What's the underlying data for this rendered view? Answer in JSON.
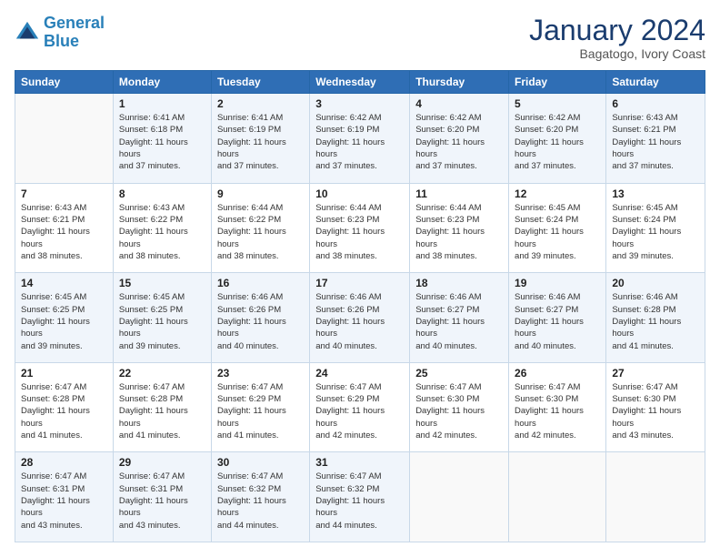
{
  "header": {
    "logo_line1": "General",
    "logo_line2": "Blue",
    "month": "January 2024",
    "location": "Bagatogo, Ivory Coast"
  },
  "weekdays": [
    "Sunday",
    "Monday",
    "Tuesday",
    "Wednesday",
    "Thursday",
    "Friday",
    "Saturday"
  ],
  "weeks": [
    [
      {
        "day": "",
        "sunrise": "",
        "sunset": "",
        "daylight": ""
      },
      {
        "day": "1",
        "sunrise": "Sunrise: 6:41 AM",
        "sunset": "Sunset: 6:18 PM",
        "daylight": "Daylight: 11 hours and 37 minutes."
      },
      {
        "day": "2",
        "sunrise": "Sunrise: 6:41 AM",
        "sunset": "Sunset: 6:19 PM",
        "daylight": "Daylight: 11 hours and 37 minutes."
      },
      {
        "day": "3",
        "sunrise": "Sunrise: 6:42 AM",
        "sunset": "Sunset: 6:19 PM",
        "daylight": "Daylight: 11 hours and 37 minutes."
      },
      {
        "day": "4",
        "sunrise": "Sunrise: 6:42 AM",
        "sunset": "Sunset: 6:20 PM",
        "daylight": "Daylight: 11 hours and 37 minutes."
      },
      {
        "day": "5",
        "sunrise": "Sunrise: 6:42 AM",
        "sunset": "Sunset: 6:20 PM",
        "daylight": "Daylight: 11 hours and 37 minutes."
      },
      {
        "day": "6",
        "sunrise": "Sunrise: 6:43 AM",
        "sunset": "Sunset: 6:21 PM",
        "daylight": "Daylight: 11 hours and 37 minutes."
      }
    ],
    [
      {
        "day": "7",
        "sunrise": "Sunrise: 6:43 AM",
        "sunset": "Sunset: 6:21 PM",
        "daylight": "Daylight: 11 hours and 38 minutes."
      },
      {
        "day": "8",
        "sunrise": "Sunrise: 6:43 AM",
        "sunset": "Sunset: 6:22 PM",
        "daylight": "Daylight: 11 hours and 38 minutes."
      },
      {
        "day": "9",
        "sunrise": "Sunrise: 6:44 AM",
        "sunset": "Sunset: 6:22 PM",
        "daylight": "Daylight: 11 hours and 38 minutes."
      },
      {
        "day": "10",
        "sunrise": "Sunrise: 6:44 AM",
        "sunset": "Sunset: 6:23 PM",
        "daylight": "Daylight: 11 hours and 38 minutes."
      },
      {
        "day": "11",
        "sunrise": "Sunrise: 6:44 AM",
        "sunset": "Sunset: 6:23 PM",
        "daylight": "Daylight: 11 hours and 38 minutes."
      },
      {
        "day": "12",
        "sunrise": "Sunrise: 6:45 AM",
        "sunset": "Sunset: 6:24 PM",
        "daylight": "Daylight: 11 hours and 39 minutes."
      },
      {
        "day": "13",
        "sunrise": "Sunrise: 6:45 AM",
        "sunset": "Sunset: 6:24 PM",
        "daylight": "Daylight: 11 hours and 39 minutes."
      }
    ],
    [
      {
        "day": "14",
        "sunrise": "Sunrise: 6:45 AM",
        "sunset": "Sunset: 6:25 PM",
        "daylight": "Daylight: 11 hours and 39 minutes."
      },
      {
        "day": "15",
        "sunrise": "Sunrise: 6:45 AM",
        "sunset": "Sunset: 6:25 PM",
        "daylight": "Daylight: 11 hours and 39 minutes."
      },
      {
        "day": "16",
        "sunrise": "Sunrise: 6:46 AM",
        "sunset": "Sunset: 6:26 PM",
        "daylight": "Daylight: 11 hours and 40 minutes."
      },
      {
        "day": "17",
        "sunrise": "Sunrise: 6:46 AM",
        "sunset": "Sunset: 6:26 PM",
        "daylight": "Daylight: 11 hours and 40 minutes."
      },
      {
        "day": "18",
        "sunrise": "Sunrise: 6:46 AM",
        "sunset": "Sunset: 6:27 PM",
        "daylight": "Daylight: 11 hours and 40 minutes."
      },
      {
        "day": "19",
        "sunrise": "Sunrise: 6:46 AM",
        "sunset": "Sunset: 6:27 PM",
        "daylight": "Daylight: 11 hours and 40 minutes."
      },
      {
        "day": "20",
        "sunrise": "Sunrise: 6:46 AM",
        "sunset": "Sunset: 6:28 PM",
        "daylight": "Daylight: 11 hours and 41 minutes."
      }
    ],
    [
      {
        "day": "21",
        "sunrise": "Sunrise: 6:47 AM",
        "sunset": "Sunset: 6:28 PM",
        "daylight": "Daylight: 11 hours and 41 minutes."
      },
      {
        "day": "22",
        "sunrise": "Sunrise: 6:47 AM",
        "sunset": "Sunset: 6:28 PM",
        "daylight": "Daylight: 11 hours and 41 minutes."
      },
      {
        "day": "23",
        "sunrise": "Sunrise: 6:47 AM",
        "sunset": "Sunset: 6:29 PM",
        "daylight": "Daylight: 11 hours and 41 minutes."
      },
      {
        "day": "24",
        "sunrise": "Sunrise: 6:47 AM",
        "sunset": "Sunset: 6:29 PM",
        "daylight": "Daylight: 11 hours and 42 minutes."
      },
      {
        "day": "25",
        "sunrise": "Sunrise: 6:47 AM",
        "sunset": "Sunset: 6:30 PM",
        "daylight": "Daylight: 11 hours and 42 minutes."
      },
      {
        "day": "26",
        "sunrise": "Sunrise: 6:47 AM",
        "sunset": "Sunset: 6:30 PM",
        "daylight": "Daylight: 11 hours and 42 minutes."
      },
      {
        "day": "27",
        "sunrise": "Sunrise: 6:47 AM",
        "sunset": "Sunset: 6:30 PM",
        "daylight": "Daylight: 11 hours and 43 minutes."
      }
    ],
    [
      {
        "day": "28",
        "sunrise": "Sunrise: 6:47 AM",
        "sunset": "Sunset: 6:31 PM",
        "daylight": "Daylight: 11 hours and 43 minutes."
      },
      {
        "day": "29",
        "sunrise": "Sunrise: 6:47 AM",
        "sunset": "Sunset: 6:31 PM",
        "daylight": "Daylight: 11 hours and 43 minutes."
      },
      {
        "day": "30",
        "sunrise": "Sunrise: 6:47 AM",
        "sunset": "Sunset: 6:32 PM",
        "daylight": "Daylight: 11 hours and 44 minutes."
      },
      {
        "day": "31",
        "sunrise": "Sunrise: 6:47 AM",
        "sunset": "Sunset: 6:32 PM",
        "daylight": "Daylight: 11 hours and 44 minutes."
      },
      {
        "day": "",
        "sunrise": "",
        "sunset": "",
        "daylight": ""
      },
      {
        "day": "",
        "sunrise": "",
        "sunset": "",
        "daylight": ""
      },
      {
        "day": "",
        "sunrise": "",
        "sunset": "",
        "daylight": ""
      }
    ]
  ]
}
